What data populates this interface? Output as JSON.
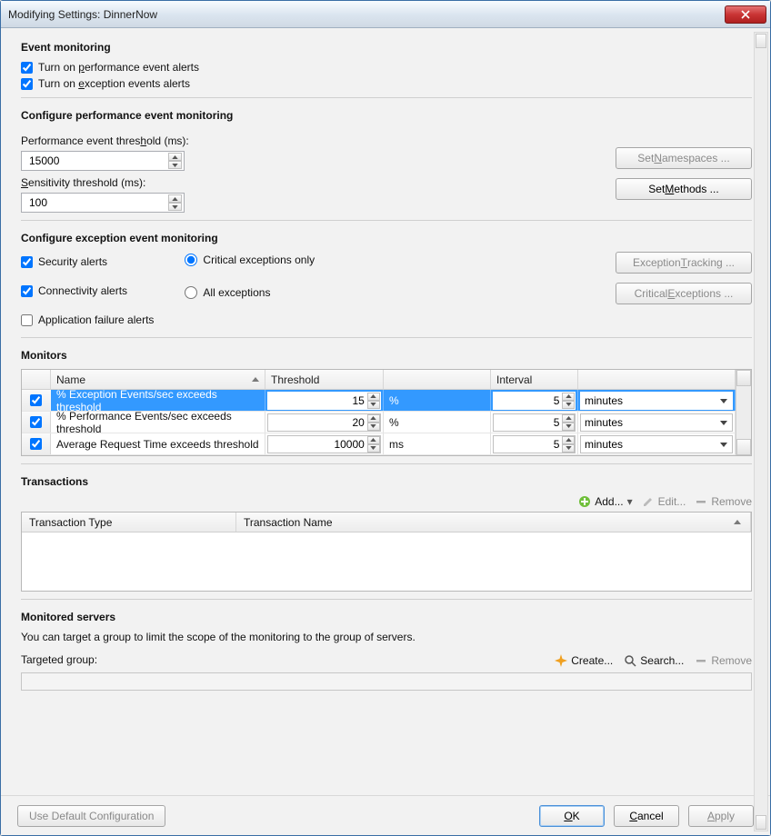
{
  "window": {
    "title": "Modifying Settings: DinnerNow"
  },
  "sections": {
    "event_monitoring": {
      "heading": "Event monitoring",
      "perf_alerts_label": "Turn on performance event alerts",
      "perf_alerts_accesskey": "p",
      "exc_alerts_label": "Turn on exception events alerts",
      "exc_alerts_accesskey": "e"
    },
    "perf_config": {
      "heading": "Configure performance event monitoring",
      "threshold_label": "Performance event threshold (ms):",
      "threshold_accesskey": "h",
      "threshold_value": "15000",
      "sensitivity_label": "Sensitivity threshold (ms):",
      "sensitivity_accesskey": "S",
      "sensitivity_value": "100",
      "set_namespaces_label": "Set Namespaces ...",
      "set_methods_label": "Set Methods ..."
    },
    "exc_config": {
      "heading": "Configure exception event monitoring",
      "security_label": "Security alerts",
      "connectivity_label": "Connectivity alerts",
      "appfail_label": "Application failure alerts",
      "critical_only_label": "Critical exceptions only",
      "all_exc_label": "All exceptions",
      "tracking_btn": "Exception Tracking ...",
      "critical_btn": "Critical Exceptions ..."
    },
    "monitors": {
      "heading": "Monitors",
      "columns": {
        "name": "Name",
        "threshold": "Threshold",
        "interval": "Interval"
      },
      "rows": [
        {
          "enabled": true,
          "name": "% Exception Events/sec exceeds threshold",
          "threshold": "15",
          "unit": "%",
          "interval": "5",
          "interval_unit": "minutes",
          "selected": true
        },
        {
          "enabled": true,
          "name": "% Performance Events/sec exceeds threshold",
          "threshold": "20",
          "unit": "%",
          "interval": "5",
          "interval_unit": "minutes",
          "selected": false
        },
        {
          "enabled": true,
          "name": "Average Request Time exceeds threshold",
          "threshold": "10000",
          "unit": "ms",
          "interval": "5",
          "interval_unit": "minutes",
          "selected": false
        }
      ]
    },
    "transactions": {
      "heading": "Transactions",
      "add_label": "Add...",
      "edit_label": "Edit...",
      "remove_label": "Remove",
      "columns": {
        "type": "Transaction Type",
        "name": "Transaction Name"
      }
    },
    "servers": {
      "heading": "Monitored servers",
      "description": "You can target a group to limit the scope of the monitoring to the group of servers.",
      "targeted_label": "Targeted group:",
      "create_label": "Create...",
      "search_label": "Search...",
      "remove_label": "Remove"
    }
  },
  "buttons": {
    "use_default": "Use Default Configuration",
    "ok": "OK",
    "cancel": "Cancel",
    "apply": "Apply"
  }
}
